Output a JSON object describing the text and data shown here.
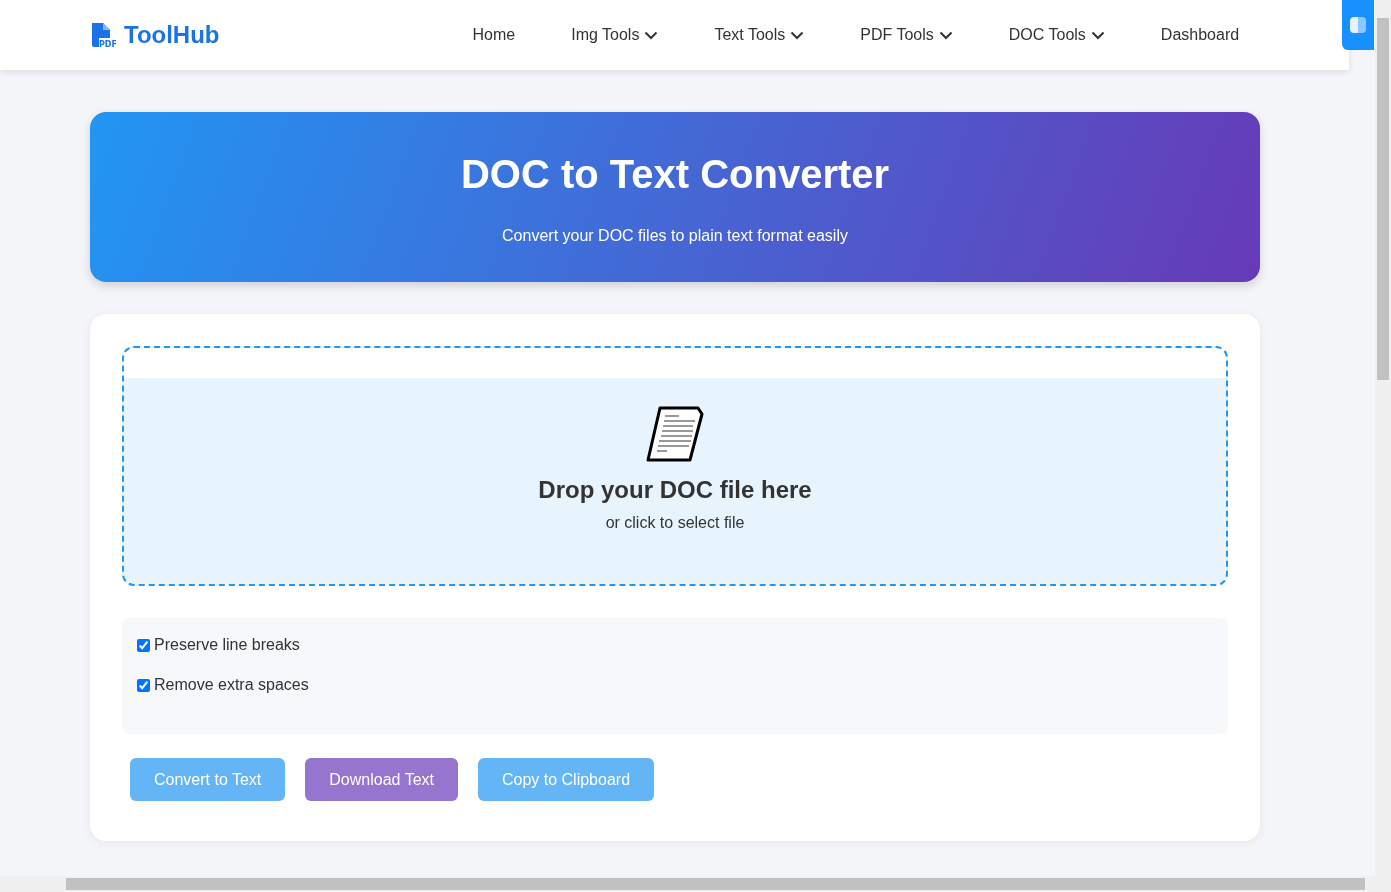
{
  "header": {
    "logo": {
      "badge": "PDF",
      "name": "ToolHub"
    },
    "nav": [
      {
        "label": "Home",
        "dropdown": false
      },
      {
        "label": "Img Tools",
        "dropdown": true
      },
      {
        "label": "Text Tools",
        "dropdown": true
      },
      {
        "label": "PDF Tools",
        "dropdown": true
      },
      {
        "label": "DOC Tools",
        "dropdown": true
      },
      {
        "label": "Dashboard",
        "dropdown": false
      }
    ]
  },
  "hero": {
    "title": "DOC to Text Converter",
    "subtitle": "Convert your DOC files to plain text format easily"
  },
  "dropzone": {
    "title": "Drop your DOC file here",
    "hint": "or click to select file"
  },
  "options": [
    {
      "label": "Preserve line breaks",
      "checked": true
    },
    {
      "label": "Remove extra spaces",
      "checked": true
    }
  ],
  "buttons": [
    {
      "label": "Convert to Text",
      "kind": "primary"
    },
    {
      "label": "Download Text",
      "kind": "secondary"
    },
    {
      "label": "Copy to Clipboard",
      "kind": "primary"
    }
  ]
}
